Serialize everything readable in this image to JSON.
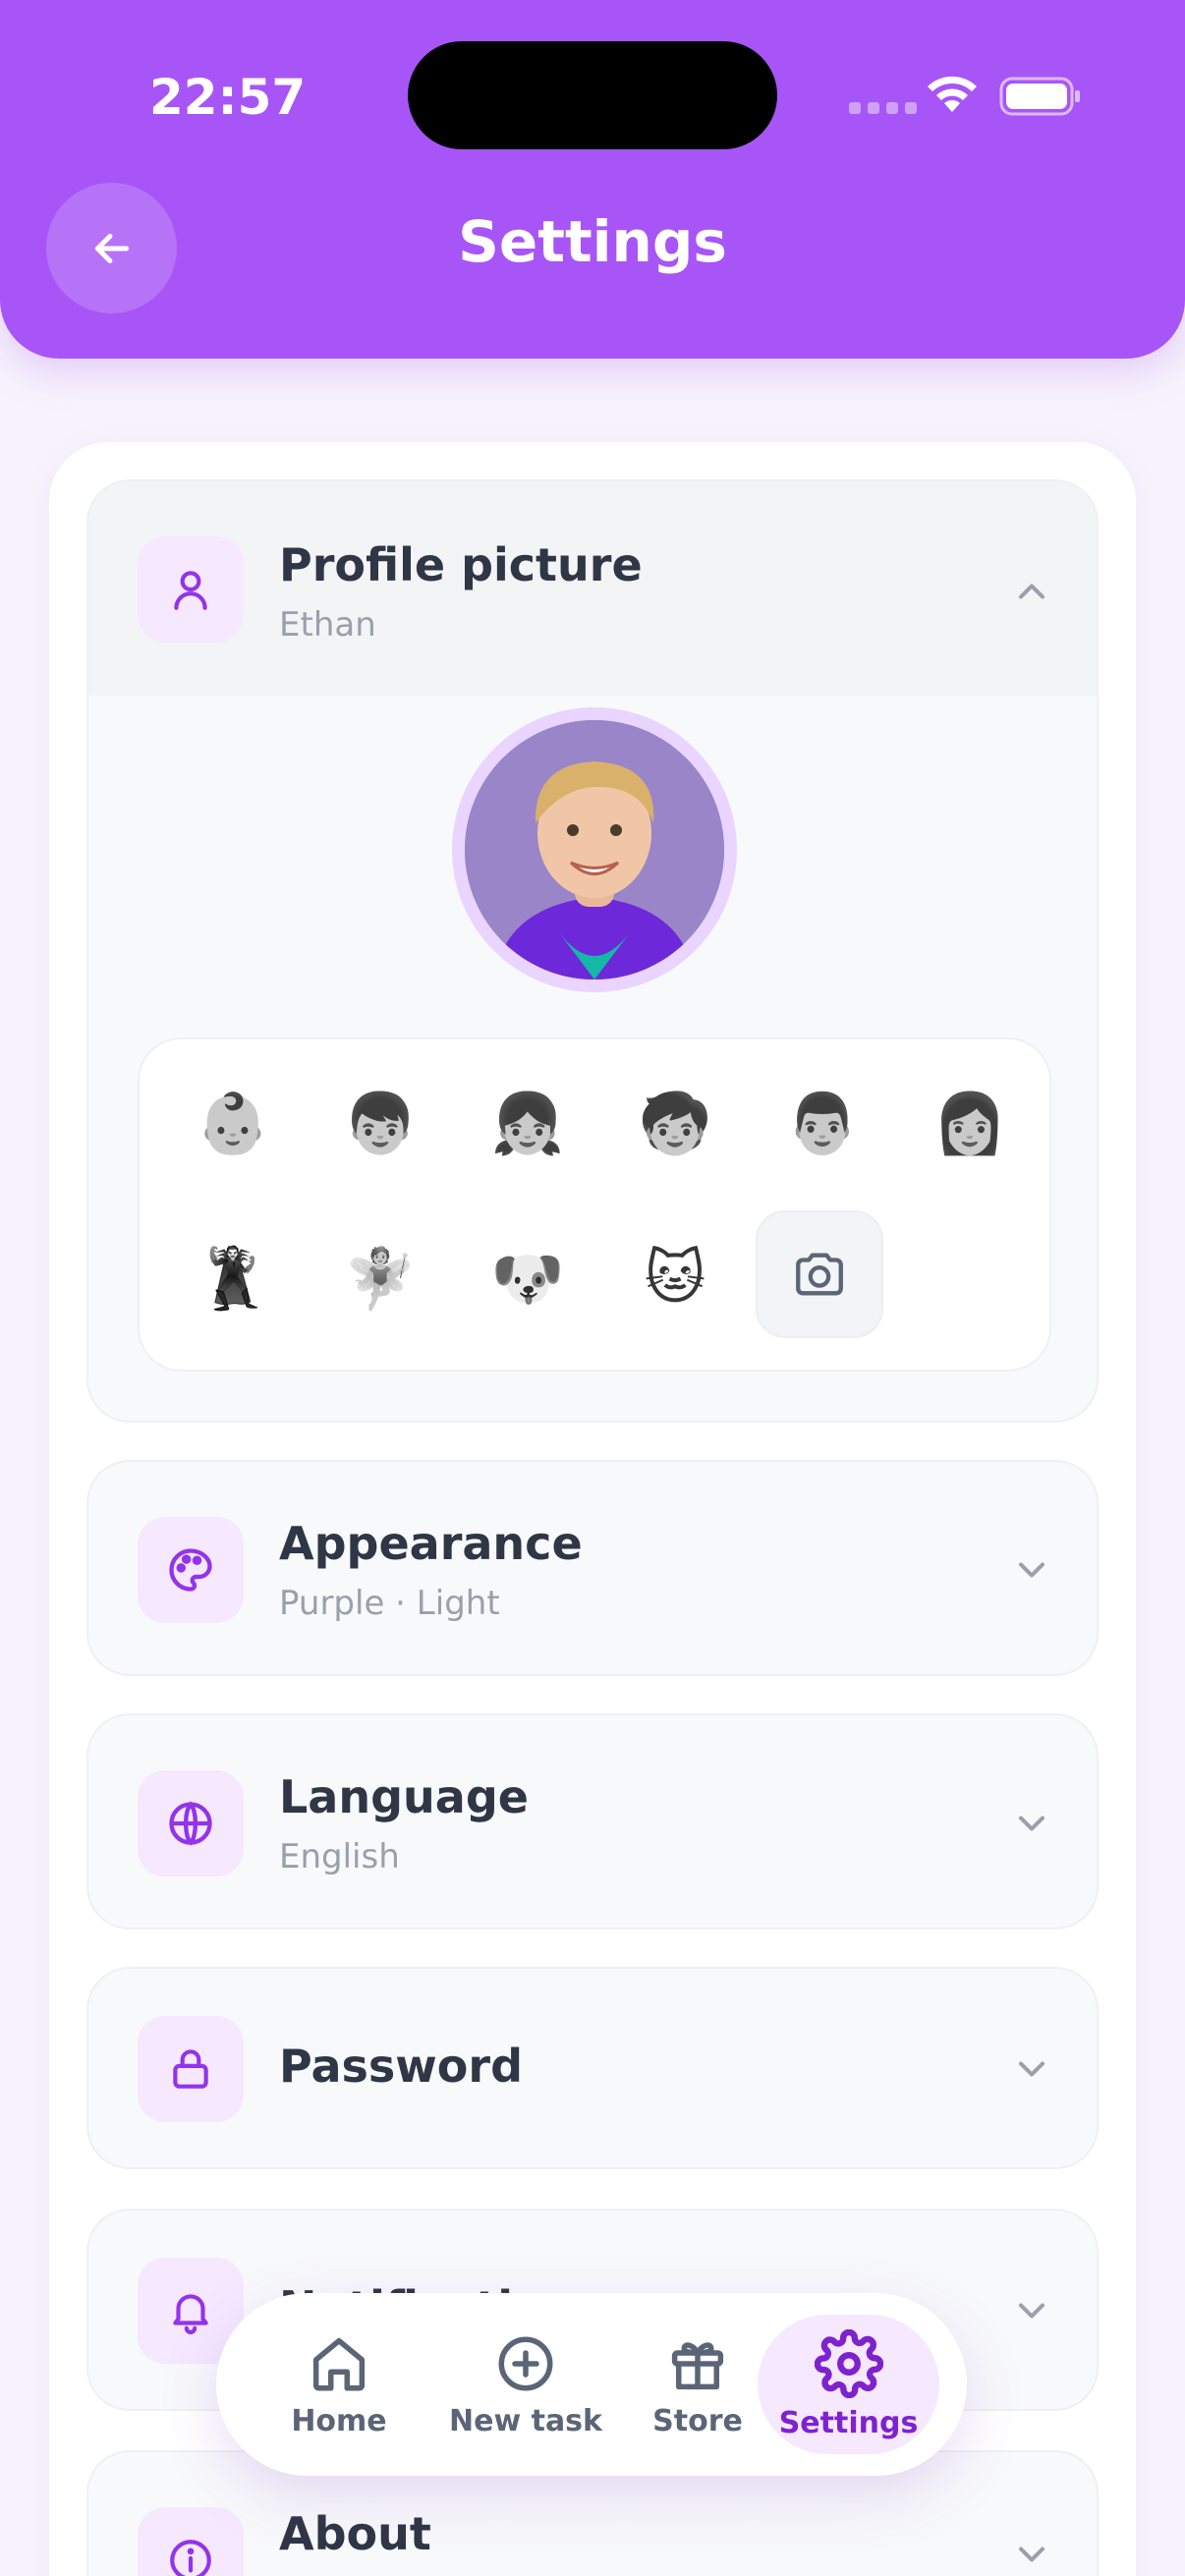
{
  "status_bar": {
    "time": "22:57"
  },
  "header": {
    "title": "Settings"
  },
  "sections": {
    "profile": {
      "title": "Profile picture",
      "subtitle": "Ethan"
    },
    "appearance": {
      "title": "Appearance",
      "subtitle": "Purple · Light"
    },
    "language": {
      "title": "Language",
      "subtitle": "English"
    },
    "password": {
      "title": "Password"
    },
    "notifications": {
      "title": "Notifications"
    },
    "about": {
      "title": "About"
    }
  },
  "avatar_options": [
    "👶",
    "👦",
    "👧",
    "🧒",
    "👨",
    "👩",
    "🦹",
    "🧚",
    "🐶",
    "🐱"
  ],
  "bottom_nav": {
    "home": "Home",
    "new_task": "New task",
    "store": "Store",
    "settings": "Settings",
    "active": "settings"
  },
  "colors": {
    "accent": "#a855f7",
    "accent_light": "#f5e8ff",
    "icon_purple": "#9333ea",
    "background": "#f7f3fc"
  }
}
